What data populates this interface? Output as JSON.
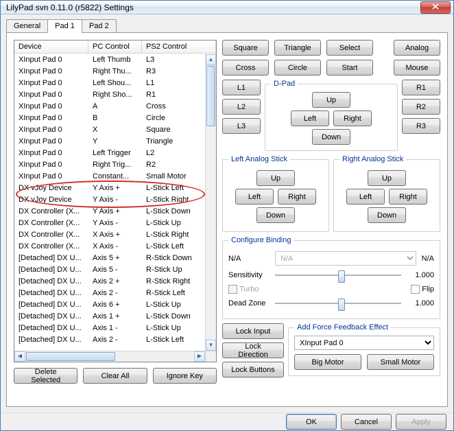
{
  "window": {
    "title": "LilyPad svn 0.11.0 (r5822) Settings"
  },
  "tabs": [
    "General",
    "Pad 1",
    "Pad 2"
  ],
  "active_tab": 1,
  "columns": {
    "device": "Device",
    "pc": "PC Control",
    "ps2": "PS2 Control"
  },
  "rows": [
    {
      "d": "XInput Pad 0",
      "pc": "Left Thumb",
      "ps": "L3"
    },
    {
      "d": "XInput Pad 0",
      "pc": "Right Thu...",
      "ps": "R3"
    },
    {
      "d": "XInput Pad 0",
      "pc": "Left Shou...",
      "ps": "L1"
    },
    {
      "d": "XInput Pad 0",
      "pc": "Right Sho...",
      "ps": "R1"
    },
    {
      "d": "XInput Pad 0",
      "pc": "A",
      "ps": "Cross"
    },
    {
      "d": "XInput Pad 0",
      "pc": "B",
      "ps": "Circle"
    },
    {
      "d": "XInput Pad 0",
      "pc": "X",
      "ps": "Square"
    },
    {
      "d": "XInput Pad 0",
      "pc": "Y",
      "ps": "Triangle"
    },
    {
      "d": "XInput Pad 0",
      "pc": "Left Trigger",
      "ps": "L2"
    },
    {
      "d": "XInput Pad 0",
      "pc": "Right Trig...",
      "ps": "R2"
    },
    {
      "d": "XInput Pad 0",
      "pc": "Constant...",
      "ps": "Small Motor"
    },
    {
      "d": "DX vJoy Device",
      "pc": "Y Axis +",
      "ps": "L-Stick Left"
    },
    {
      "d": "DX vJoy Device",
      "pc": "Y Axis -",
      "ps": "L-Stick Right"
    },
    {
      "d": "DX Controller (X...",
      "pc": "Y Axis +",
      "ps": "L-Stick Down"
    },
    {
      "d": "DX Controller (X...",
      "pc": "Y Axis -",
      "ps": "L-Stick Up"
    },
    {
      "d": "DX Controller (X...",
      "pc": "X Axis +",
      "ps": "L-Stick Right"
    },
    {
      "d": "DX Controller (X...",
      "pc": "X Axis -",
      "ps": "L-Stick Left"
    },
    {
      "d": "[Detached] DX U...",
      "pc": "Axis 5 +",
      "ps": "R-Stick Down"
    },
    {
      "d": "[Detached] DX U...",
      "pc": "Axis 5 -",
      "ps": "R-Stick Up"
    },
    {
      "d": "[Detached] DX U...",
      "pc": "Axis 2 +",
      "ps": "R-Stick Right"
    },
    {
      "d": "[Detached] DX U...",
      "pc": "Axis 2 -",
      "ps": "R-Stick Left"
    },
    {
      "d": "[Detached] DX U...",
      "pc": "Axis 6 +",
      "ps": "L-Stick Up"
    },
    {
      "d": "[Detached] DX U...",
      "pc": "Axis 1 +",
      "ps": "L-Stick Down"
    },
    {
      "d": "[Detached] DX U...",
      "pc": "Axis 1 -",
      "ps": "L-Stick Up"
    },
    {
      "d": "[Detached] DX U...",
      "pc": "Axis 2 -",
      "ps": "L-Stick Left"
    }
  ],
  "left_buttons": {
    "delete": "Delete Selected",
    "clear": "Clear All",
    "ignore": "Ignore Key"
  },
  "face": {
    "square": "Square",
    "triangle": "Triangle",
    "select": "Select",
    "analog": "Analog",
    "cross": "Cross",
    "circle": "Circle",
    "start": "Start",
    "mouse": "Mouse"
  },
  "shoulders": {
    "l1": "L1",
    "l2": "L2",
    "l3": "L3",
    "r1": "R1",
    "r2": "R2",
    "r3": "R3"
  },
  "dpad": {
    "legend": "D-Pad",
    "up": "Up",
    "down": "Down",
    "left": "Left",
    "right": "Right"
  },
  "lstick": {
    "legend": "Left Analog Stick",
    "up": "Up",
    "down": "Down",
    "left": "Left",
    "right": "Right"
  },
  "rstick": {
    "legend": "Right Analog Stick",
    "up": "Up",
    "down": "Down",
    "left": "Left",
    "right": "Right"
  },
  "configure": {
    "legend": "Configure Binding",
    "na": "N/A",
    "combo_value": "N/A",
    "suffix": "N/A",
    "sensitivity_label": "Sensitivity",
    "sensitivity_value": "1.000",
    "turbo": "Turbo",
    "flip": "Flip",
    "deadzone_label": "Dead Zone",
    "deadzone_value": "1.000"
  },
  "locks": {
    "input": "Lock Input",
    "direction": "Lock Direction",
    "buttons": "Lock Buttons"
  },
  "ff": {
    "legend": "Add Force Feedback Effect",
    "device": "XInput Pad 0",
    "big": "Big Motor",
    "small": "Small Motor"
  },
  "bottom": {
    "ok": "OK",
    "cancel": "Cancel",
    "apply": "Apply"
  }
}
